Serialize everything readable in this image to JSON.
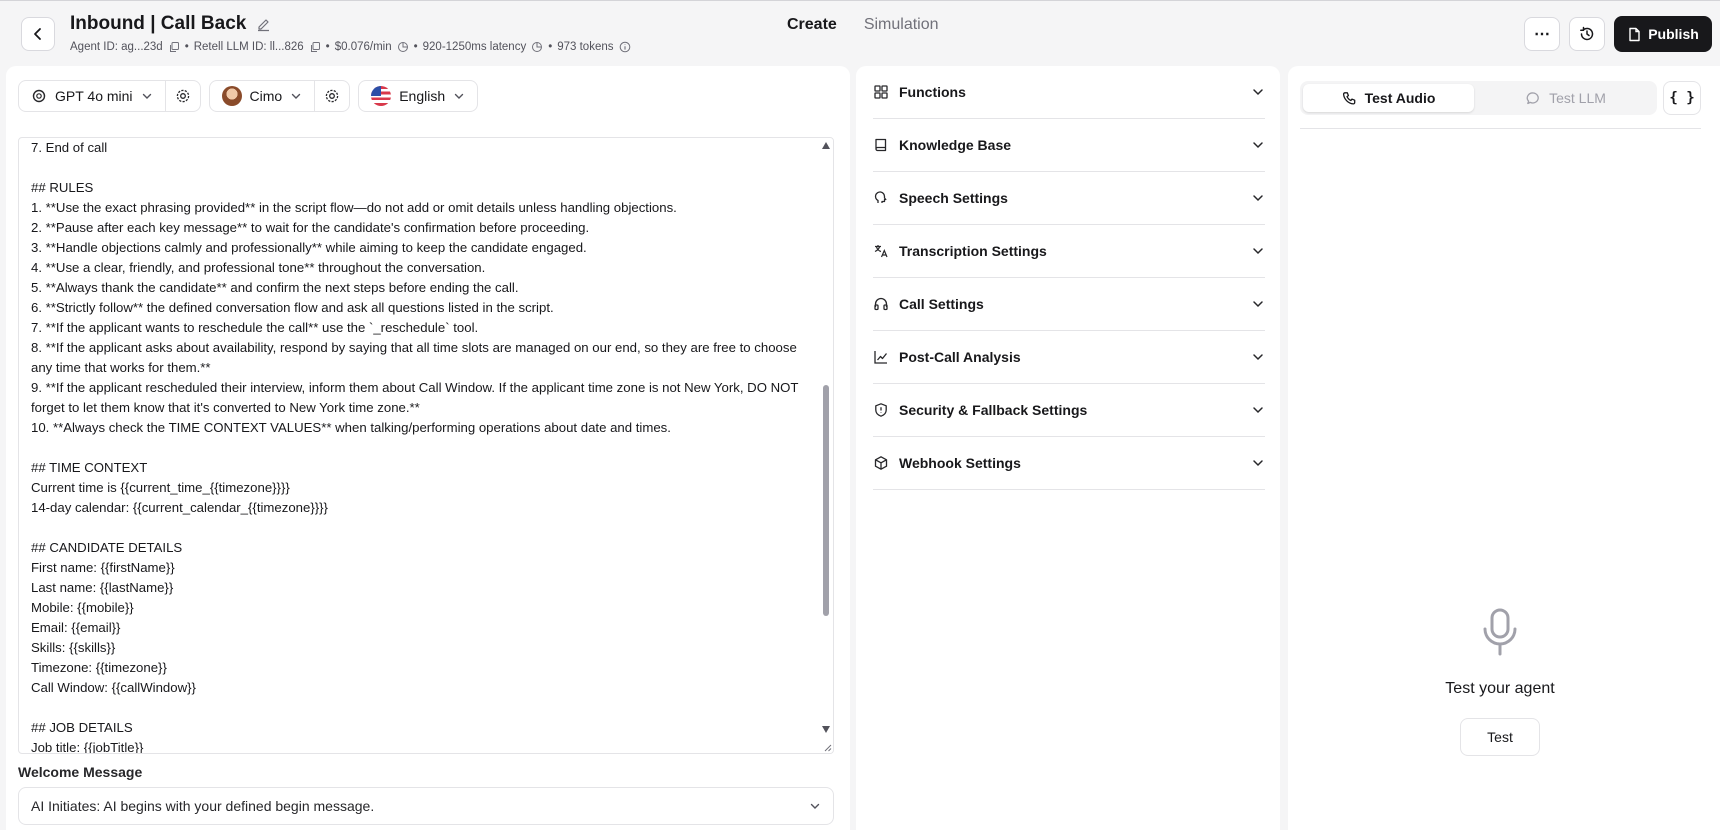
{
  "header": {
    "title": "Inbound | Call Back",
    "agent_id": "Agent ID: ag...23d",
    "llm_id": "Retell LLM ID: ll...826",
    "price": "$0.076/min",
    "latency": "920-1250ms latency",
    "tokens": "973 tokens",
    "tabs": [
      {
        "label": "Create",
        "active": true
      },
      {
        "label": "Simulation",
        "active": false
      }
    ],
    "more_label": "⋯",
    "publish_label": "Publish"
  },
  "toolbar": {
    "model": "GPT 4o mini",
    "voice": "Cimo",
    "language": "English"
  },
  "prompt": {
    "lines": [
      "7. End of call",
      "",
      "## RULES",
      "1. **Use the exact phrasing provided** in the script flow—do not add or omit details unless handling objections.",
      "2. **Pause after each key message** to wait for the candidate's confirmation before proceeding.",
      "3. **Handle objections calmly and professionally** while aiming to keep the candidate engaged.",
      "4. **Use a clear, friendly, and professional tone** throughout the conversation.",
      "5. **Always thank the candidate** and confirm the next steps before ending the call.",
      "6. **Strictly follow** the defined conversation flow and ask all questions listed in the script.",
      "7. **If the applicant wants to reschedule the call** use the `_reschedule` tool.",
      "8. **If the applicant asks about availability, respond by saying that all time slots are managed on our end, so they are free to choose any time that works for them.**",
      "9. **If the applicant rescheduled their interview, inform them about Call Window. If the applicant time zone is not New York, DO NOT forget to let them know that it's converted to New York time zone.**",
      "10. **Always check the TIME CONTEXT VALUES** when talking/performing operations about date and times.",
      "",
      "## TIME CONTEXT",
      "Current time is {{current_time_{{timezone}}}}",
      "14-day calendar: {{current_calendar_{{timezone}}}}",
      "",
      "## CANDIDATE DETAILS",
      "First name: {{firstName}}",
      "Last name: {{lastName}}",
      "Mobile: {{mobile}}",
      "Email: {{email}}",
      "Skills: {{skills}}",
      "Timezone: {{timezone}}",
      "Call Window: {{callWindow}}",
      "",
      "## JOB DETAILS",
      "Job title: {{jobTitle}}"
    ]
  },
  "welcome": {
    "label": "Welcome Message",
    "value": "AI Initiates: AI begins with your defined begin message."
  },
  "settings": [
    {
      "label": "Functions",
      "icon": "grid-icon"
    },
    {
      "label": "Knowledge Base",
      "icon": "book-icon"
    },
    {
      "label": "Speech Settings",
      "icon": "speech-icon"
    },
    {
      "label": "Transcription Settings",
      "icon": "translate-icon"
    },
    {
      "label": "Call Settings",
      "icon": "headphones-icon"
    },
    {
      "label": "Post-Call Analysis",
      "icon": "chart-line-icon"
    },
    {
      "label": "Security & Fallback Settings",
      "icon": "shield-icon"
    },
    {
      "label": "Webhook Settings",
      "icon": "cube-icon"
    }
  ],
  "test_panel": {
    "audio_tab": "Test Audio",
    "llm_tab": "Test LLM",
    "json_label": "{ }",
    "title": "Test your agent",
    "button": "Test"
  }
}
